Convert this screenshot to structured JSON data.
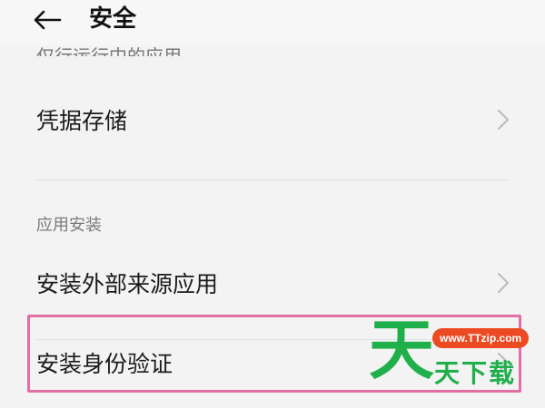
{
  "header": {
    "back_icon": "arrow-left-icon",
    "title": "安全"
  },
  "clipped_row": {
    "label": "仅行运行中的应用"
  },
  "items": [
    {
      "label": "凭据存储",
      "icon": "chevron-right-icon"
    }
  ],
  "section": {
    "title": "应用安装",
    "items": [
      {
        "label": "安装外部来源应用",
        "icon": "chevron-right-icon"
      },
      {
        "label": "安装身份验证",
        "icon": "chevron-right-icon"
      }
    ]
  },
  "watermark": {
    "big": "天",
    "url": "www.TTzip.com",
    "text": "天下载"
  },
  "colors": {
    "background": "#f3f3f3",
    "highlight": "#e26ea3",
    "watermark_green": "#1faf4b",
    "watermark_orange": "#ec4a22"
  }
}
